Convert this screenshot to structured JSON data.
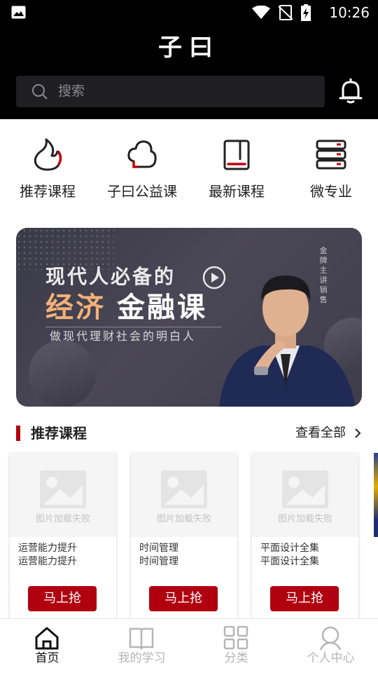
{
  "status_bar": {
    "time": "10:26",
    "icons": [
      "image-icon",
      "wifi-icon",
      "no-signal-icon",
      "battery-charging-icon"
    ]
  },
  "header": {
    "title": "子曰",
    "search_placeholder": "搜索"
  },
  "quick_nav": [
    {
      "label": "推荐课程",
      "icon": "flame-icon"
    },
    {
      "label": "子曰公益课",
      "icon": "cloud-icon"
    },
    {
      "label": "最新课程",
      "icon": "book-icon"
    },
    {
      "label": "微专业",
      "icon": "server-stack-icon"
    }
  ],
  "banner": {
    "line1": "现代人必备的",
    "line2_highlight": "经济",
    "line2_rest": "金融课",
    "subtitle": "做现代理财社会的明白人",
    "vertical_text": "金牌主讲销售"
  },
  "section": {
    "title": "推荐课程",
    "more_label": "查看全部"
  },
  "courses": [
    {
      "image_text": "图片加载失败",
      "title_line1": "运营能力提升",
      "title_line2": "运营能力提升",
      "button": "马上抢"
    },
    {
      "image_text": "图片加载失败",
      "title_line1": "时间管理",
      "title_line2": "时间管理",
      "button": "马上抢"
    },
    {
      "image_text": "图片加载失败",
      "title_line1": "平面设计全集",
      "title_line2": "平面设计全集",
      "button": "马上抢"
    }
  ],
  "tabs": [
    {
      "label": "首页",
      "icon": "home-icon",
      "active": true
    },
    {
      "label": "我的学习",
      "icon": "open-book-icon",
      "active": false
    },
    {
      "label": "分类",
      "icon": "grid-icon",
      "active": false
    },
    {
      "label": "个人中心",
      "icon": "person-icon",
      "active": false
    }
  ],
  "colors": {
    "accent": "#b0000f",
    "header_bg": "#000000",
    "search_bg": "#1e1e23",
    "banner_highlight": "#f2b179"
  }
}
